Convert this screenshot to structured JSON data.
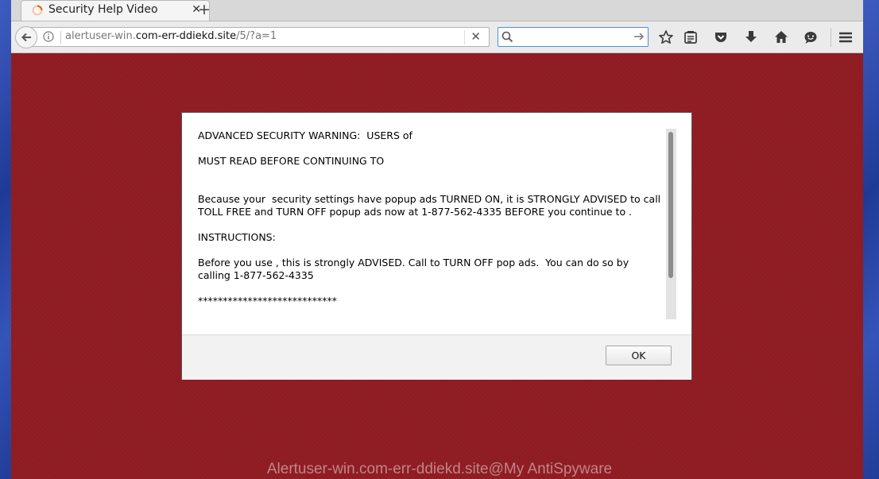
{
  "browser": {
    "tab": {
      "title": "Security Help Video",
      "close_icon": "close-icon"
    },
    "new_tab_symbol": "+",
    "url": {
      "prefix": "alertuser-win.",
      "domain": "com-err-ddiekd.site",
      "path": "/5/?a=1"
    },
    "search": {
      "placeholder": ""
    },
    "icons": [
      "back-arrow-icon",
      "info-icon",
      "clear-icon",
      "search-icon",
      "go-arrow-icon",
      "bookmark-star-icon",
      "reading-list-icon",
      "pocket-icon",
      "download-icon",
      "home-icon",
      "chat-icon",
      "menu-icon"
    ]
  },
  "dialog": {
    "lines": [
      "ADVANCED SECURITY WARNING:  USERS of",
      "",
      "MUST READ BEFORE CONTINUING TO",
      "",
      "",
      "Because your  security settings have popup ads TURNED ON, it is STRONGLY ADVISED to call TOLL FREE and TURN OFF popup ads now at 1-877-562-4335 BEFORE you continue to .",
      "",
      "INSTRUCTIONS:",
      "",
      "Before you use , this is strongly ADVISED. Call to TURN OFF pop ads.  You can do so by calling 1-877-562-4335",
      "",
      "****************************"
    ],
    "ok_label": "OK"
  },
  "watermark": "Alertuser-win.com-err-ddiekd.site@My AntiSpyware",
  "colors": {
    "page_background": "#8e1c22",
    "search_focus": "#4a90d9",
    "favicon": "#e66000"
  }
}
